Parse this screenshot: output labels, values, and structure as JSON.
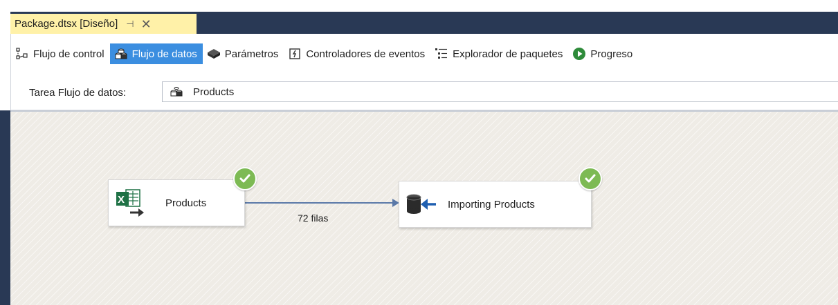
{
  "document_tab": {
    "title": "Package.dtsx [Diseño]",
    "pin_glyph": "⊣",
    "close_glyph": "✕"
  },
  "toolbar": {
    "items": [
      {
        "label": "Flujo de control",
        "icon": "control-flow-icon",
        "active": false
      },
      {
        "label": "Flujo de datos",
        "icon": "data-flow-icon",
        "active": true
      },
      {
        "label": "Parámetros",
        "icon": "parameters-icon",
        "active": false
      },
      {
        "label": "Controladores de eventos",
        "icon": "event-handlers-icon",
        "active": false
      },
      {
        "label": "Explorador de paquetes",
        "icon": "package-explorer-icon",
        "active": false
      },
      {
        "label": "Progreso",
        "icon": "progress-icon",
        "active": false
      }
    ]
  },
  "task_selector": {
    "label": "Tarea Flujo de datos:",
    "value": "Products"
  },
  "canvas": {
    "source": {
      "label": "Products",
      "icon": "excel-source-icon",
      "status": "success"
    },
    "destination": {
      "label": "Importing Products",
      "icon": "oledb-destination-icon",
      "status": "success"
    },
    "path": {
      "label": "72 filas"
    }
  },
  "colors": {
    "tab_background": "#fff1a8",
    "chrome_dark": "#293955",
    "active_tab": "#3b8ee0",
    "success_check": "#7dba54",
    "connector": "#5b79a8"
  }
}
